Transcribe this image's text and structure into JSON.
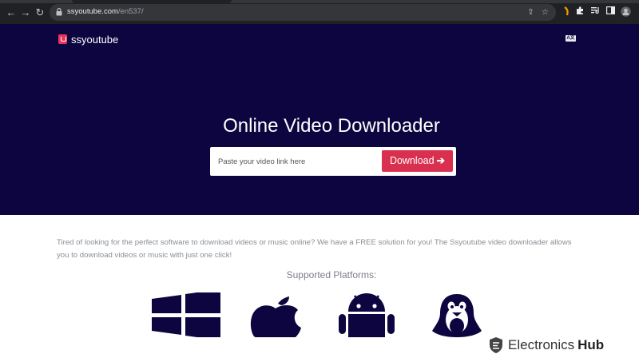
{
  "browser": {
    "url_domain": "ssyoutube.com",
    "url_path": "/en537/",
    "icons": [
      "back-icon",
      "forward-icon",
      "reload-icon",
      "lock-icon",
      "share-icon",
      "bookmark-star-icon",
      "extension-icon",
      "puzzle-icon",
      "media-icon",
      "sidebar-icon",
      "profile-icon"
    ]
  },
  "header": {
    "brand": "ssyoutube",
    "brand_color": "#e8345a",
    "lang_label": "A文"
  },
  "hero": {
    "title": "Online Video Downloader",
    "search_placeholder": "Paste your video link here",
    "download_label": "Download",
    "download_arrow": "➔",
    "background": "#0d0540",
    "button_color": "#d9304f"
  },
  "content": {
    "description": "Tired of looking for the perfect software to download videos or music online? We have a FREE solution for you! The Ssyoutube video downloader allows you to download videos or music with just one click!",
    "platforms_title": "Supported Platforms:",
    "platforms": [
      "windows-icon",
      "apple-icon",
      "android-icon",
      "linux-icon"
    ]
  },
  "watermark": {
    "text": "Electronics",
    "bold": "Hub"
  }
}
